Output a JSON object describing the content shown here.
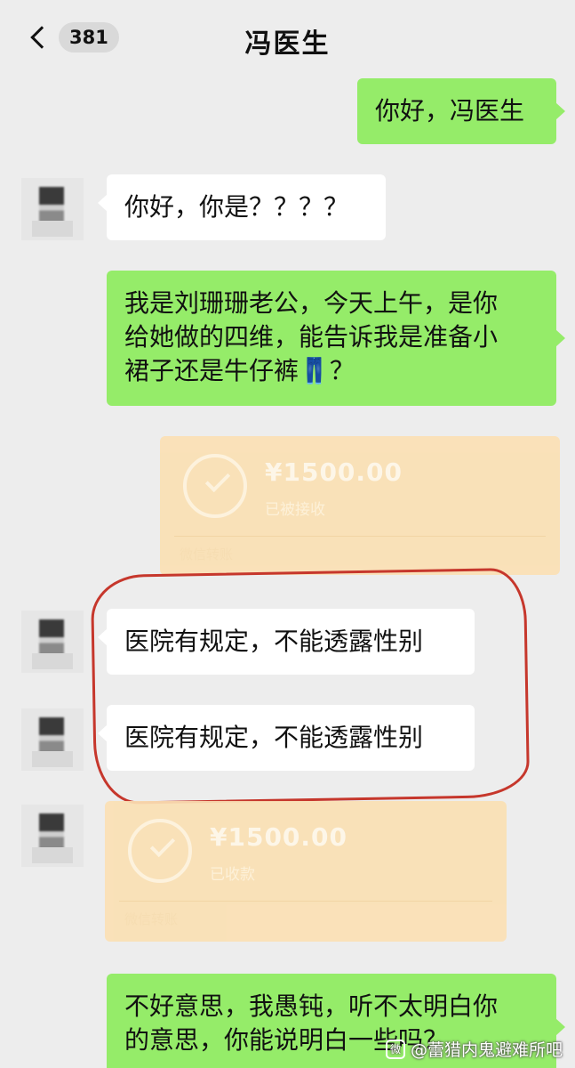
{
  "header": {
    "unread_count": "381",
    "title": "冯医生"
  },
  "messages": [
    {
      "side": "right",
      "type": "text",
      "text": "你好，冯医生"
    },
    {
      "side": "left",
      "type": "text",
      "text": "你好，你是？？？？"
    },
    {
      "side": "right",
      "type": "text",
      "lines": [
        "我是刘珊珊老公，今天上午，是你",
        "给她做的四维，能告诉我是准备小",
        "裙子还是牛仔裤👖？"
      ]
    },
    {
      "side": "right",
      "type": "transfer",
      "amount": "¥1500.00",
      "status": "已被接收",
      "footer": "微信转账"
    },
    {
      "side": "left",
      "type": "text",
      "text": "医院有规定，不能透露性别"
    },
    {
      "side": "left",
      "type": "text",
      "text": "医院有规定，不能透露性别"
    },
    {
      "side": "left",
      "type": "transfer",
      "amount": "¥1500.00",
      "status": "已收款",
      "footer": "微信转账"
    },
    {
      "side": "right",
      "type": "text",
      "lines": [
        "不好意思，我愚钝，听不太明白你",
        "的意思，你能说明白一些吗？"
      ]
    }
  ],
  "watermark": {
    "icon": "weibo-icon",
    "text": "@蕾猎内鬼避难所吧"
  },
  "colors": {
    "background": "#ededed",
    "green_bubble": "#95ec69",
    "white_bubble": "#ffffff",
    "transfer": "#fbe0b4",
    "highlight": "#c6372c"
  }
}
